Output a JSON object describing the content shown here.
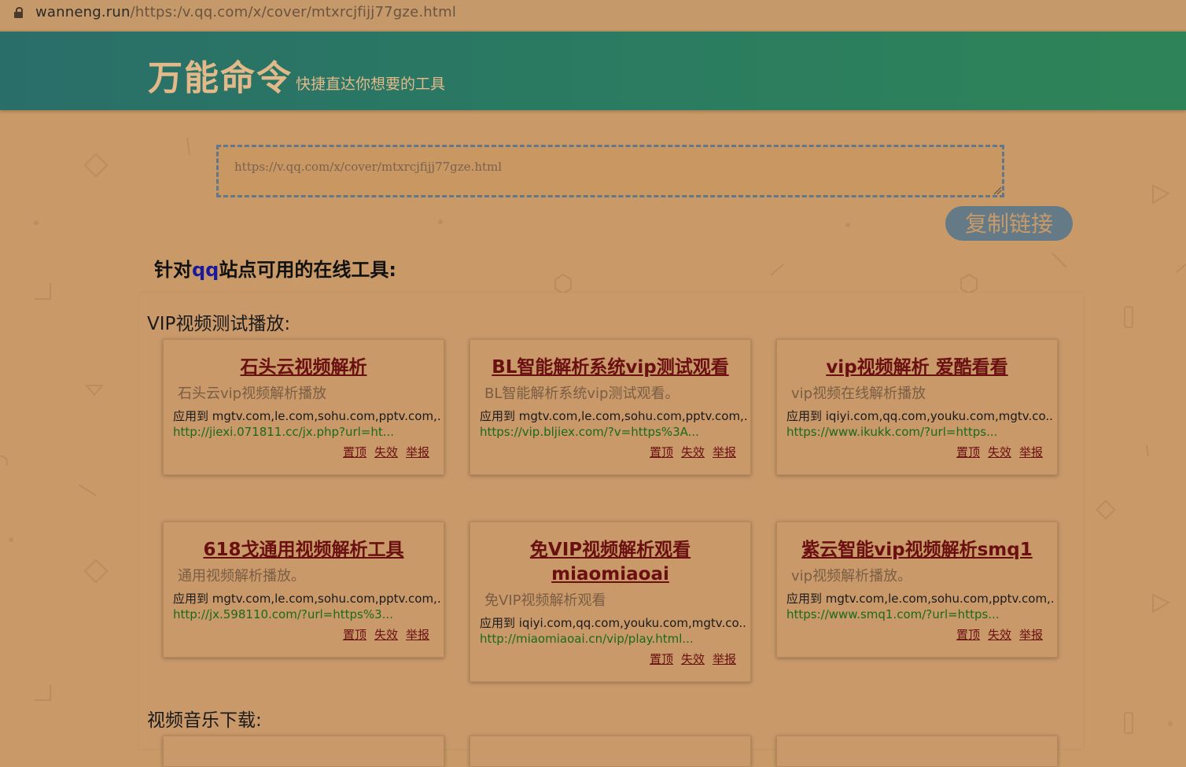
{
  "browser": {
    "url_host": "wanneng.run",
    "url_path": "/https:/v.qq.com/x/cover/mtxrcjfijj77gze.html"
  },
  "header": {
    "logo": "万能命令",
    "tagline": "快捷直达你想要的工具"
  },
  "input": {
    "value": "https://v.qq.com/x/cover/mtxrcjfijj77gze.html"
  },
  "copy_button": "复制链接",
  "tools_heading": {
    "prefix": "针对",
    "site": "qq",
    "suffix": "站点可用的在线工具:"
  },
  "groups": [
    {
      "title": "VIP视频测试播放:",
      "cards": [
        {
          "title": "石头云视频解析",
          "desc": "石头云vip视频解析播放",
          "apply": "应用到 mgtv.com,le.com,sohu.com,pptv.com,...",
          "url": "http://jiexi.071811.cc/jx.php?url=ht..."
        },
        {
          "title": "BL智能解析系统vip测试观看",
          "desc": "BL智能解析系统vip测试观看。",
          "apply": "应用到 mgtv.com,le.com,sohu.com,pptv.com,...",
          "url": "https://vip.bljiex.com/?v=https%3A..."
        },
        {
          "title": "vip视频解析 爱酷看看",
          "desc": "vip视频在线解析播放",
          "apply": "应用到 iqiyi.com,qq.com,youku.com,mgtv.co...",
          "url": "https://www.ikukk.com/?url=https..."
        },
        {
          "title": "618戈通用视频解析工具",
          "desc": "通用视频解析播放。",
          "apply": "应用到 mgtv.com,le.com,sohu.com,pptv.com,...",
          "url": "http://jx.598110.com/?url=https%3..."
        },
        {
          "title": "免VIP视频解析观看miaomiaoai",
          "desc": "免VIP视频解析观看",
          "apply": "应用到 iqiyi.com,qq.com,youku.com,mgtv.co...",
          "url": "http://miaomiaoai.cn/vip/play.html..."
        },
        {
          "title": "紫云智能vip视频解析smq1",
          "desc": "vip视频解析播放。",
          "apply": "应用到 mgtv.com,le.com,sohu.com,pptv.com,...",
          "url": "https://www.smq1.com/?url=https..."
        }
      ]
    },
    {
      "title": "视频音乐下载:"
    }
  ],
  "card_actions": {
    "pin": "置顶",
    "invalid": "失效",
    "report": "举报"
  },
  "colors": {
    "background": "#c99a68",
    "header_gradient_start": "#2a6e6a",
    "header_gradient_end": "#2e8458",
    "logo_text": "#e3b98a",
    "card_title": "#6a1010",
    "card_url": "#1a6a1a",
    "copy_button_bg": "#647a87",
    "input_border": "#62788a",
    "site_name": "#1a1a9a"
  }
}
